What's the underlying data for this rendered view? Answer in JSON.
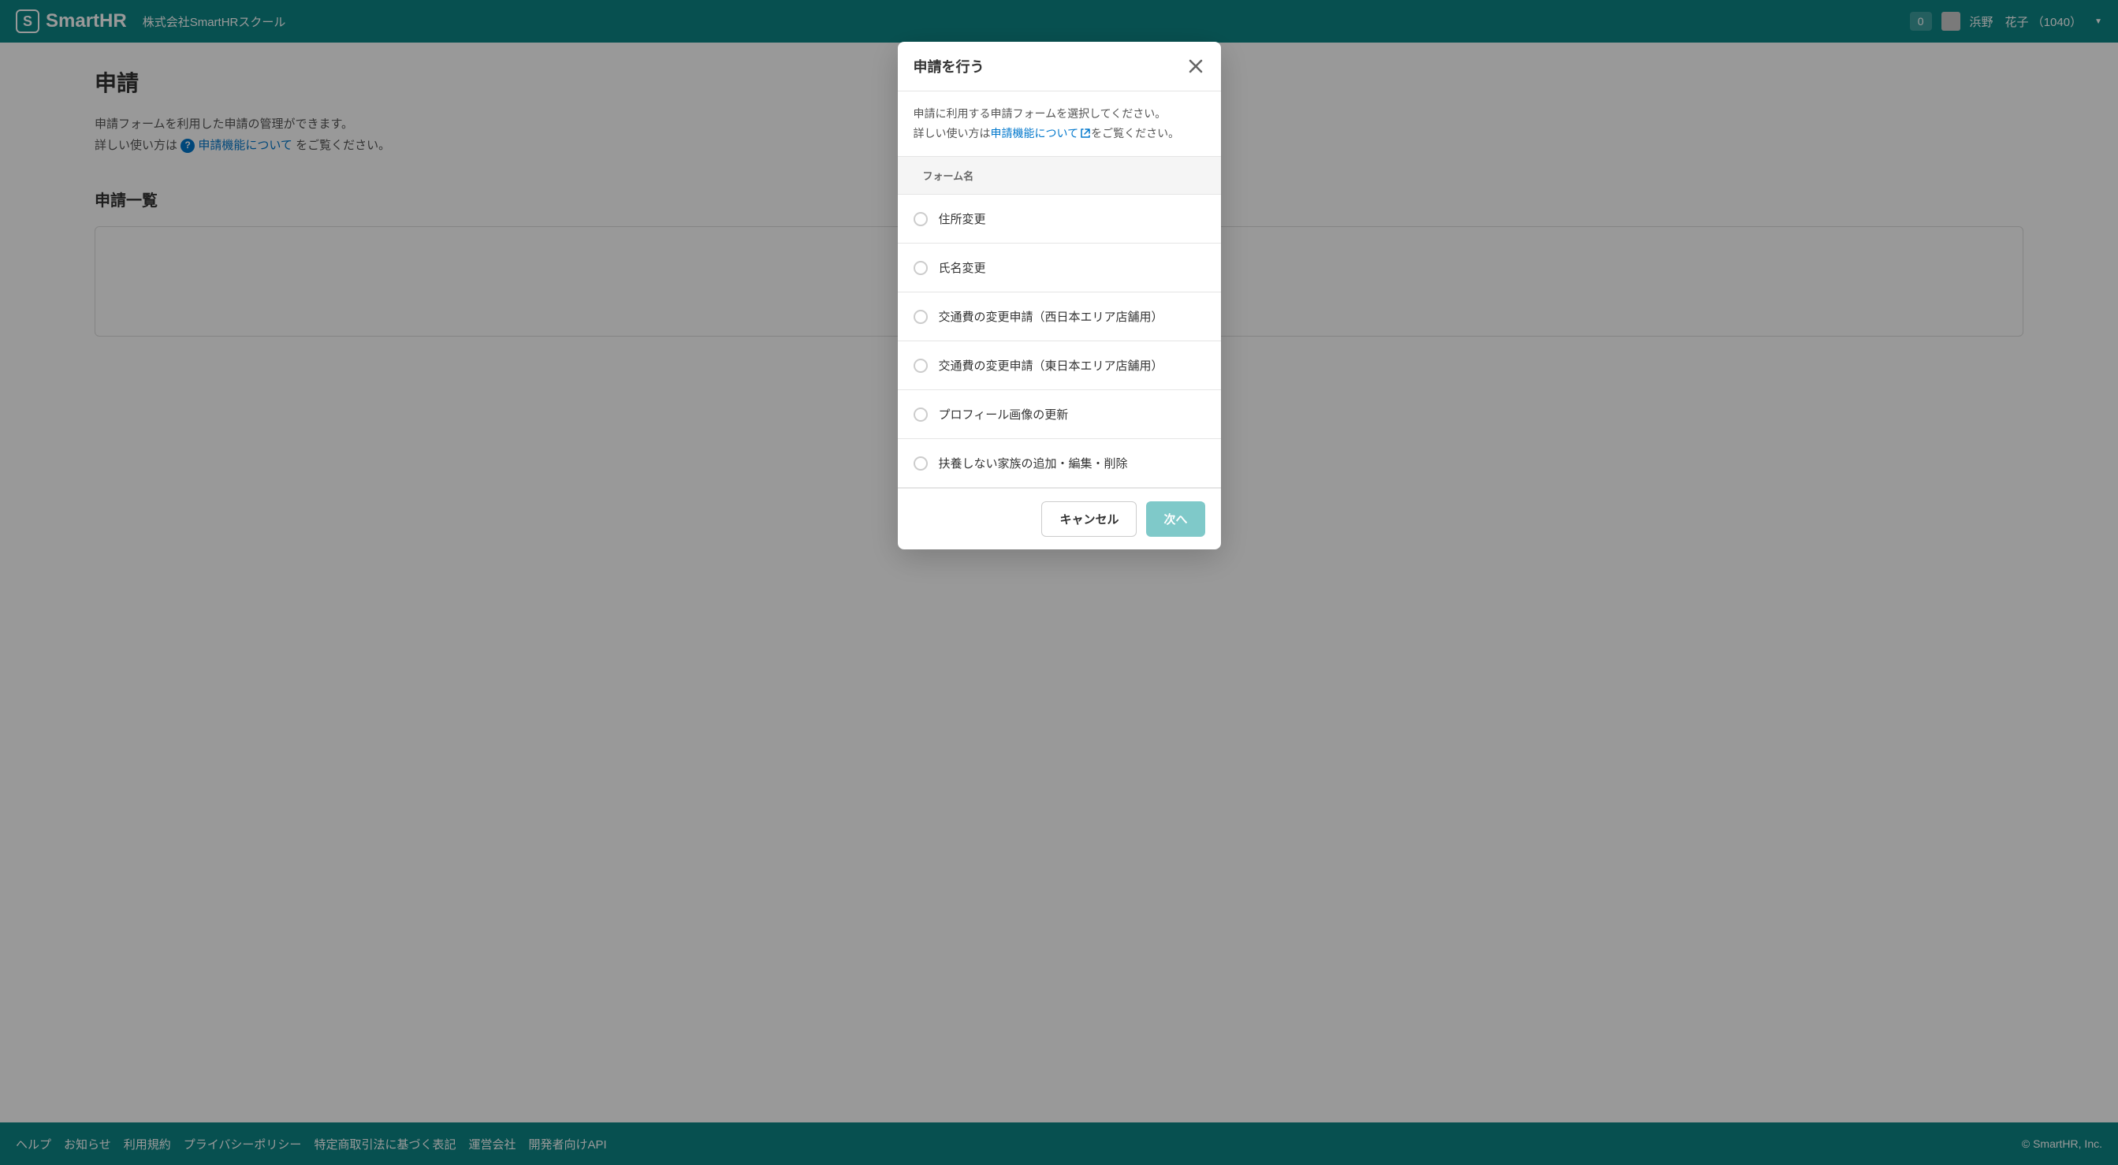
{
  "header": {
    "logo_text": "SmartHR",
    "logo_icon_text": "S",
    "company_name": "株式会社SmartHRスクール",
    "notification_count": "0",
    "user_name": "浜野　花子 （1040）"
  },
  "page": {
    "title": "申請",
    "desc_line1": "申請フォームを利用した申請の管理ができます。",
    "desc_line2_pre": "詳しい使い方は",
    "desc_link": "申請機能について",
    "desc_line2_post": " をご覧ください。",
    "section_title": "申請一覧"
  },
  "modal": {
    "title": "申請を行う",
    "desc_line1": "申請に利用する申請フォームを選択してください。",
    "desc_line2_pre": "詳しい使い方は",
    "desc_link": "申請機能について",
    "desc_line2_post": "をご覧ください。",
    "column_header": "フォーム名",
    "forms": [
      {
        "name": "住所変更"
      },
      {
        "name": "氏名変更"
      },
      {
        "name": "交通費の変更申請（西日本エリア店舗用）"
      },
      {
        "name": "交通費の変更申請（東日本エリア店舗用）"
      },
      {
        "name": "プロフィール画像の更新"
      },
      {
        "name": "扶養しない家族の追加・編集・削除"
      }
    ],
    "cancel_label": "キャンセル",
    "next_label": "次へ"
  },
  "footer": {
    "links": [
      "ヘルプ",
      "お知らせ",
      "利用規約",
      "プライバシーポリシー",
      "特定商取引法に基づく表記",
      "運営会社",
      "開発者向けAPI"
    ],
    "copyright": "© SmartHR, Inc."
  }
}
